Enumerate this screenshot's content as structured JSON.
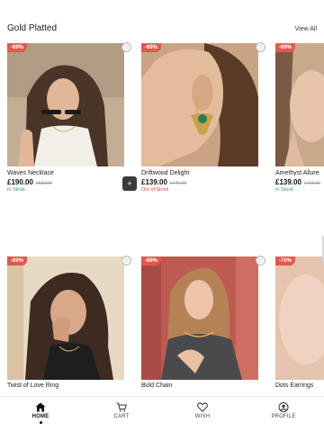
{
  "section": {
    "title": "Gold Platted",
    "view_all": "View All"
  },
  "products": [
    {
      "name": "Waves Necklace",
      "price": "£190.00",
      "old_price": "£632.00",
      "discount": "-69%",
      "stock": "In Stock"
    },
    {
      "name": "Driftwood Delight",
      "price": "£139.00",
      "old_price": "£449.00",
      "discount": "-69%",
      "stock": "Out of Stock"
    },
    {
      "name": "Amethyst Allure",
      "price": "£139.00",
      "old_price": "£463.00",
      "discount": "-69%",
      "stock": "In Stock"
    },
    {
      "name": "Twist of Love Ring",
      "discount": "-69%"
    },
    {
      "name": "Bold Chain",
      "discount": "-69%"
    },
    {
      "name": "Dots Earrings",
      "discount": "-70%"
    }
  ],
  "add_button": "+",
  "nav": [
    {
      "label": "HOME",
      "icon": "home-icon",
      "active": true
    },
    {
      "label": "CART",
      "icon": "cart-icon"
    },
    {
      "label": "WISH",
      "icon": "heart-icon"
    },
    {
      "label": "PROFILE",
      "icon": "profile-icon"
    }
  ],
  "colors": {
    "badge": "#e0594f",
    "in_stock": "#2a9d6f",
    "out_of_stock": "#d23b3b",
    "add_button": "#3a3a3a"
  }
}
